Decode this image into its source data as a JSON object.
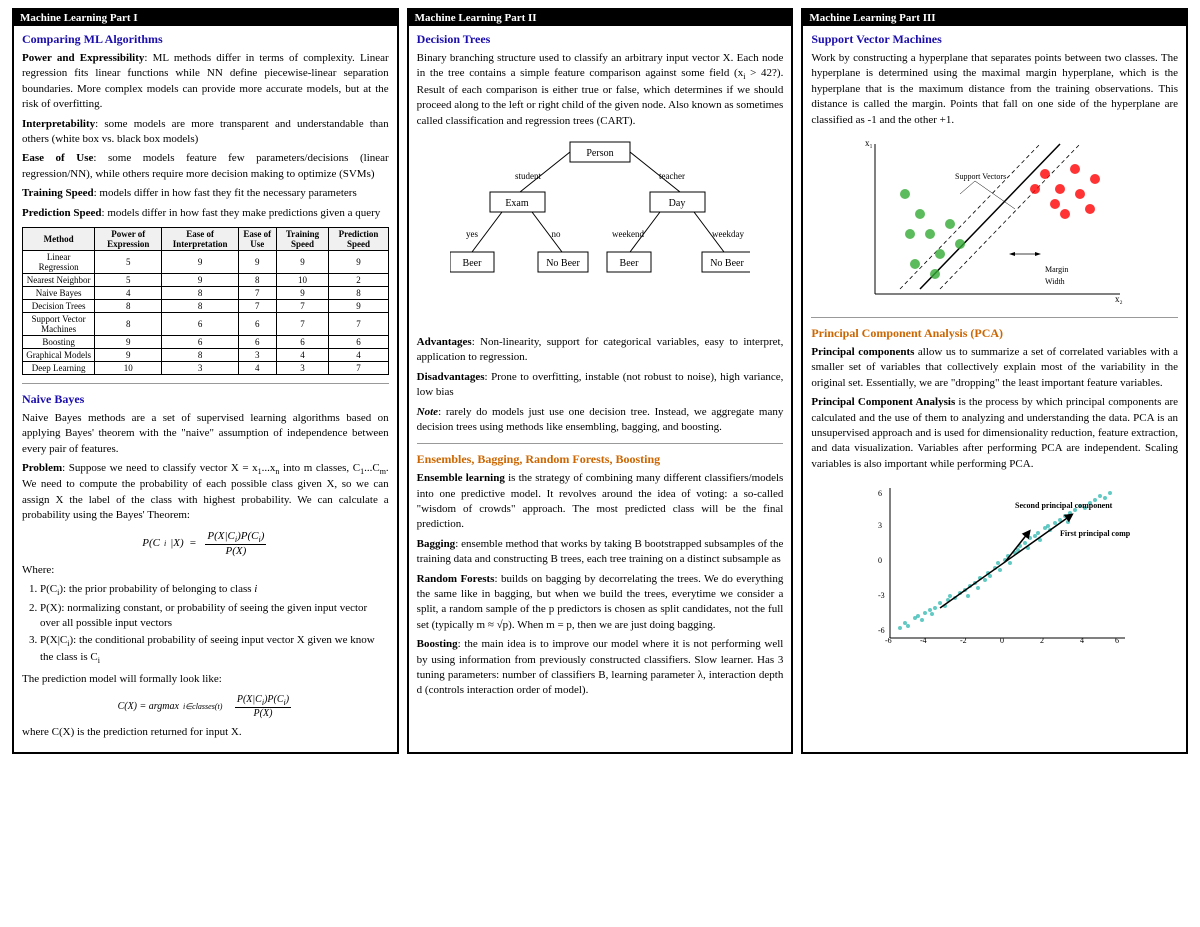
{
  "col1": {
    "header": "Machine Learning Part I",
    "section1_title": "Comparing ML Algorithms",
    "section1_content": [
      {
        "label": "Power and Expressibility",
        "text": ": ML methods differ in terms of complexity. Linear regression fits linear functions while NN define piecewise-linear separation boundaries. More complex models can provide more accurate models, but at the risk of overfitting."
      },
      {
        "label": "Interpretability",
        "text": ": some models are more transparent and understandable than others (white box vs. black box models)"
      },
      {
        "label": "Ease of Use",
        "text": ": some models feature few parameters/decisions (linear regression/NN), while others require more decision making to optimize (SVMs)"
      },
      {
        "label": "Training Speed",
        "text": ": models differ in how fast they fit the necessary parameters"
      },
      {
        "label": "Prediction Speed",
        "text": ": models differ in how fast they make predictions given a query"
      }
    ],
    "table_headers": [
      "Method",
      "Power of Expression",
      "Ease of Interpretation",
      "Ease of Use",
      "Training Speed",
      "Prediction Speed"
    ],
    "table_rows": [
      [
        "Linear Regression",
        "5",
        "9",
        "9",
        "9",
        "9"
      ],
      [
        "Nearest Neighbor",
        "5",
        "9",
        "8",
        "10",
        "2"
      ],
      [
        "Naive Bayes",
        "4",
        "8",
        "7",
        "9",
        "8"
      ],
      [
        "Decision Trees",
        "8",
        "8",
        "7",
        "7",
        "9"
      ],
      [
        "Support Vector Machines",
        "8",
        "6",
        "6",
        "7",
        "7"
      ],
      [
        "Boosting",
        "9",
        "6",
        "6",
        "6",
        "6"
      ],
      [
        "Graphical Models",
        "9",
        "8",
        "3",
        "4",
        "4"
      ],
      [
        "Deep Learning",
        "10",
        "3",
        "4",
        "3",
        "7"
      ]
    ],
    "section2_title": "Naive Bayes",
    "section2_p1": "Naive Bayes methods are a set of supervised learning algorithms based on applying Bayes' theorem with the \"naive\" assumption of independence between every pair of features.",
    "section2_p2": "Suppose we need to classify vector X = x₁...xₙ into m classes, C₁...Cₘ. We need to compute the probability of each possible class given X, so we can assign X the label of the class with highest probability. We can calculate a probability using the Bayes' Theorem:",
    "section2_formula": "P(Cᵢ|X) = P(X|Cᵢ)P(Cᵢ) / P(X)",
    "section2_where": "Where:",
    "section2_list": [
      "P(Cᵢ): the prior probability of belonging to class i",
      "P(X): normalizing constant, or probability of seeing the given input vector over all possible input vectors",
      "P(X|Cᵢ): the conditional probability of seeing input vector X given we know the class is Cᵢ"
    ],
    "section2_p3": "The prediction model will formally look like:",
    "section2_formula2": "C(X) = argmaxᵢ∈classes(t) P(X|Cᵢ)P(Cᵢ)/P(X)",
    "section2_p4": "where C(X) is the prediction returned for input X."
  },
  "col2": {
    "header": "Machine Learning Part II",
    "section1_title": "Decision Trees",
    "section1_p1": "Binary branching structure used to classify an arbitrary input vector X. Each node in the tree contains a simple feature comparison against some field (xᵢ > 42?). Result of each comparison is either true or false, which determines if we should proceed along to the left or right child of the given node. Also known as sometimes called classification and regression trees (CART).",
    "tree_nodes": {
      "root": "Person",
      "l1_left": "Exam",
      "l1_right": "Day",
      "l1_left_label": "student",
      "l1_right_label": "teacher",
      "l2_1": "Beer",
      "l2_2": "No Beer",
      "l2_3": "Beer",
      "l2_4": "No Beer",
      "l2_1_label": "yes",
      "l2_2_label": "no",
      "l2_3_label": "weekend",
      "l2_4_label": "weekday"
    },
    "advantages": "Non-linearity, support for categorical variables, easy to interpret, application to regression.",
    "disadvantages": "Prone to overfitting, instable (not robust to noise), high variance, low bias",
    "note": "rarely do models just use one decision tree. Instead, we aggregate many decision trees using methods like ensembling, bagging, and boosting.",
    "section2_title": "Ensembles, Bagging, Random Forests, Boosting",
    "ensemble_def": " is the strategy of combining many different classifiers/models into one predictive model. It revolves around the idea of voting: a so-called \"wisdom of crowds\" approach. The most predicted class will be the final prediction.",
    "bagging_def": ": ensemble method that works by taking B bootstrapped subsamples of the training data and constructing B trees, each tree training on a distinct subsample as",
    "rf_def": ": builds on bagging by decorrelating the trees. We do everything the same like in bagging, but when we build the trees, everytime we consider a split, a random sample of the p predictors is chosen as split candidates, not the full set (typically m ≈ √p). When m = p, then we are just doing bagging.",
    "boosting_def": ": the main idea is to improve our model where it is not performing well by using information from previously constructed classifiers. Slow learner. Has 3 tuning parameters: number of classifiers B, learning parameter λ, interaction depth d (controls interaction order of model)."
  },
  "col3": {
    "header": "Machine Learning Part III",
    "section1_title": "Support Vector Machines",
    "section1_p1": "Work by constructing a hyperplane that separates points between two classes. The hyperplane is determined using the maximal margin hyperplane, which is the hyperplane that is the maximum distance from the training observations. This distance is called the margin. Points that fall on one side of the hyperplane are classified as -1 and the other +1.",
    "section2_title": "Principal Component Analysis (PCA)",
    "section2_p1": " allow us to summarize a set of correlated variables with a smaller set of variables that collectively explain most of the variability in the original set. Essentially, we are \"dropping\" the least important feature variables.",
    "section2_p2": " is the process by which principal components are calculated and the use of them to analyzing and understanding the data. PCA is an unsupervised approach and is used for dimensionality reduction, feature extraction, and data visualization. Variables after performing PCA are independent. Scaling variables is also important while performing PCA."
  }
}
